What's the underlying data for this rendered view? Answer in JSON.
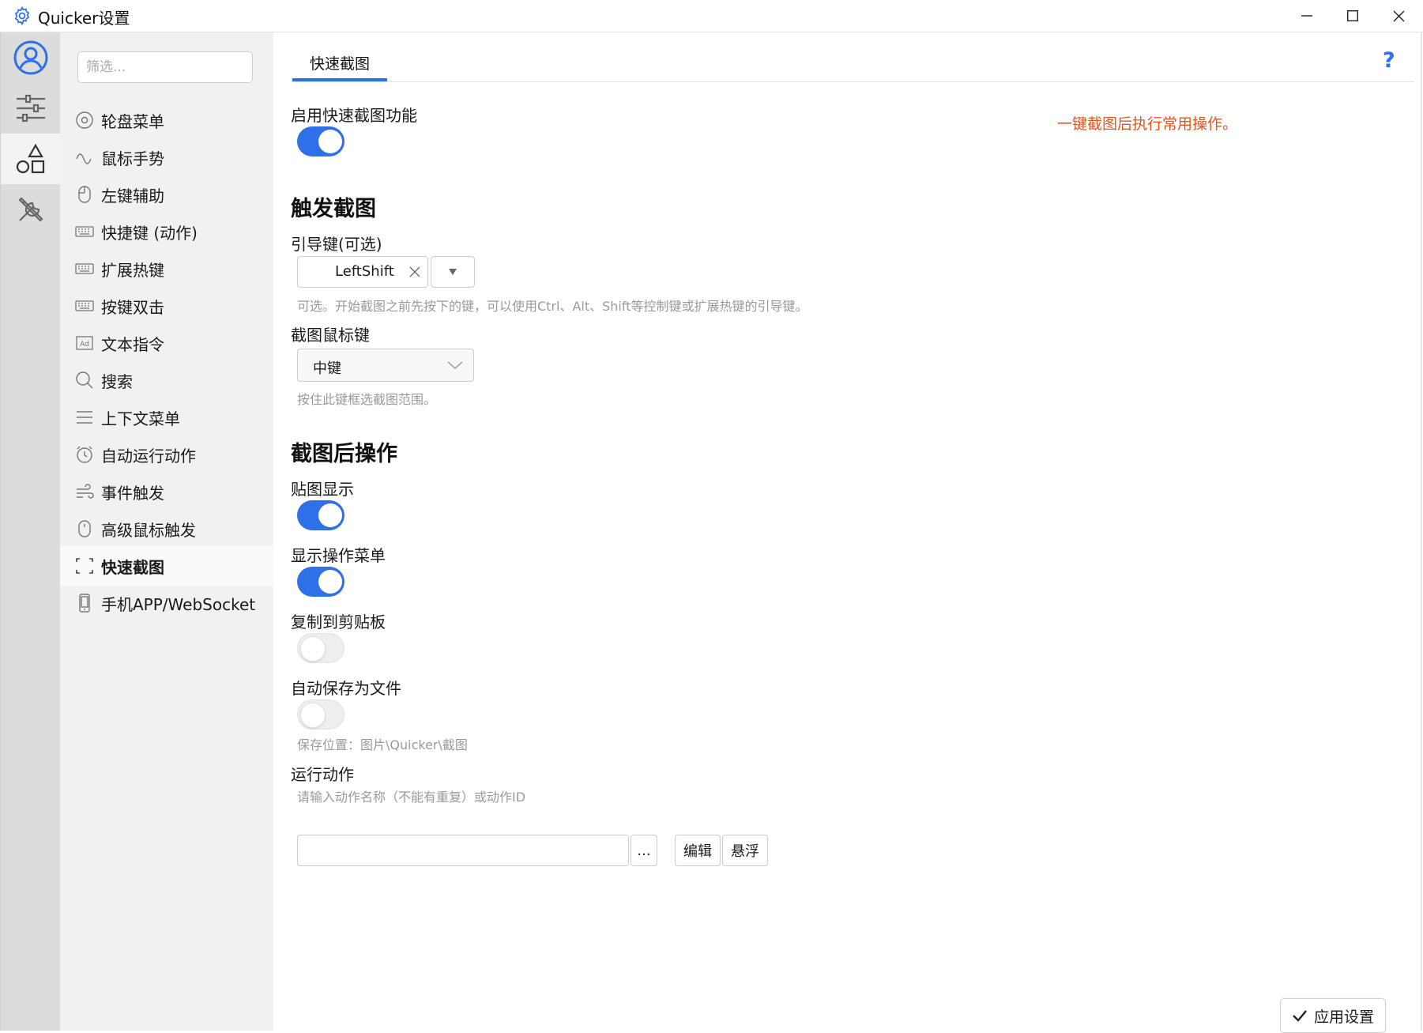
{
  "window": {
    "title": "Quicker设置"
  },
  "filter": {
    "placeholder": "筛选..."
  },
  "nav": {
    "items": [
      {
        "label": "轮盘菜单"
      },
      {
        "label": "鼠标手势"
      },
      {
        "label": "左键辅助"
      },
      {
        "label": "快捷键 (动作)"
      },
      {
        "label": "扩展热键"
      },
      {
        "label": "按键双击"
      },
      {
        "label": "文本指令"
      },
      {
        "label": "搜索"
      },
      {
        "label": "上下文菜单"
      },
      {
        "label": "自动运行动作"
      },
      {
        "label": "事件触发"
      },
      {
        "label": "高级鼠标触发"
      },
      {
        "label": "快速截图"
      },
      {
        "label": "手机APP/WebSocket"
      }
    ],
    "active": "快速截图"
  },
  "main": {
    "tab": "快速截图",
    "help": "?",
    "enable": {
      "label": "启用快速截图功能",
      "on": true
    },
    "note": "一键截图后执行常用操作。",
    "trigger": {
      "heading": "触发截图",
      "lead_key_label": "引导键(可选)",
      "lead_key_value": "LeftShift",
      "lead_key_hint": "可选。开始截图之前先按下的键，可以使用Ctrl、Alt、Shift等控制键或扩展热键的引导键。",
      "mouse_key_label": "截图鼠标键",
      "mouse_key_value": "中键",
      "mouse_key_hint": "按住此键框选截图范围。"
    },
    "after": {
      "heading": "截图后操作",
      "paste_label": "贴图显示",
      "paste_on": true,
      "menu_label": "显示操作菜单",
      "menu_on": true,
      "clipboard_label": "复制到剪贴板",
      "clipboard_on": false,
      "save_label": "自动保存为文件",
      "save_on": false,
      "save_hint": "保存位置：图片\\Quicker\\截图",
      "run_label": "运行动作",
      "run_placeholder": "请输入动作名称（不能有重复）或动作ID",
      "run_value": "",
      "browse_label": "...",
      "edit_label": "编辑",
      "float_label": "悬浮"
    },
    "apply_label": "应用设置"
  },
  "colors": {
    "accent": "#2f6fe8",
    "note": "#e8541a"
  }
}
